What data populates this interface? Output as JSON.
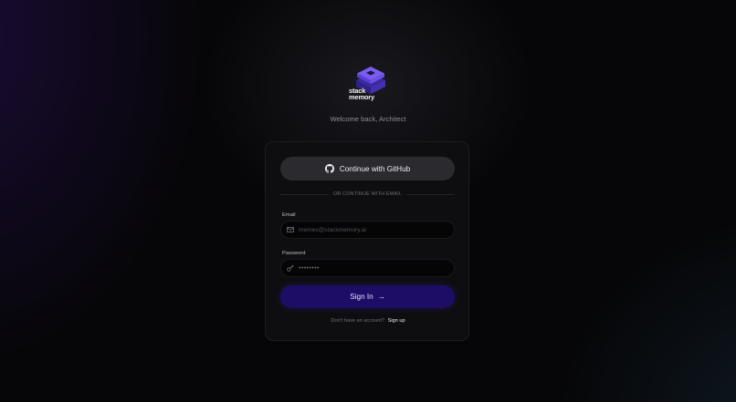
{
  "brand": {
    "logo_line1": "stack",
    "logo_line2": "memory",
    "accent": "#6a4bd8"
  },
  "welcome_text": "Welcome back, Architect",
  "auth": {
    "github_label": "Continue with GitHub",
    "divider_text": "OR CONTINUE WITH EMAIL",
    "email_label": "Email",
    "email_placeholder": "memex@stackmemory.ai",
    "password_label": "Password",
    "password_mask": "••••••••",
    "signin_label": "Sign In",
    "signin_icon": "arrow-right-icon",
    "footer_text": "Don't have an account?",
    "signup_link": "Sign up"
  },
  "colors": {
    "background": "#060608",
    "card": "#0e0e11",
    "github_button": "#2a2a2f",
    "signin_button": "#1d0d66"
  }
}
